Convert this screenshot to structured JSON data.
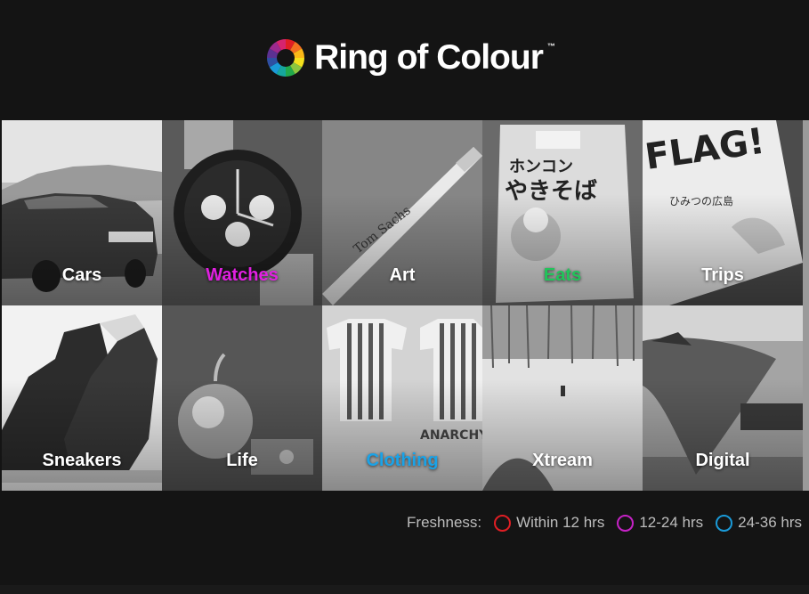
{
  "brand": {
    "name": "Ring of Colour",
    "trademark": "™"
  },
  "categories": [
    {
      "label": "Cars",
      "color": "#ffffff"
    },
    {
      "label": "Watches",
      "color": "#e020e0"
    },
    {
      "label": "Art",
      "color": "#ffffff"
    },
    {
      "label": "Eats",
      "color": "#21c45a"
    },
    {
      "label": "Trips",
      "color": "#ffffff"
    },
    {
      "label": "Sneakers",
      "color": "#ffffff"
    },
    {
      "label": "Life",
      "color": "#ffffff"
    },
    {
      "label": "Clothing",
      "color": "#1aa3e8"
    },
    {
      "label": "Xtream",
      "color": "#ffffff"
    },
    {
      "label": "Digital",
      "color": "#ffffff"
    }
  ],
  "legend": {
    "title": "Freshness:",
    "items": [
      {
        "label": "Within 12 hrs",
        "color": "#e01e24"
      },
      {
        "label": "12-24 hrs",
        "color": "#c622c6"
      },
      {
        "label": "24-36 hrs",
        "color": "#1a9ad8"
      }
    ]
  },
  "logo_colors": [
    "#e01e24",
    "#f36f21",
    "#fbb817",
    "#f4e01c",
    "#8cc63f",
    "#22a94b",
    "#16a79d",
    "#1a9ad8",
    "#2e4fa2",
    "#5b3192",
    "#9b2a8e",
    "#d6246e"
  ]
}
